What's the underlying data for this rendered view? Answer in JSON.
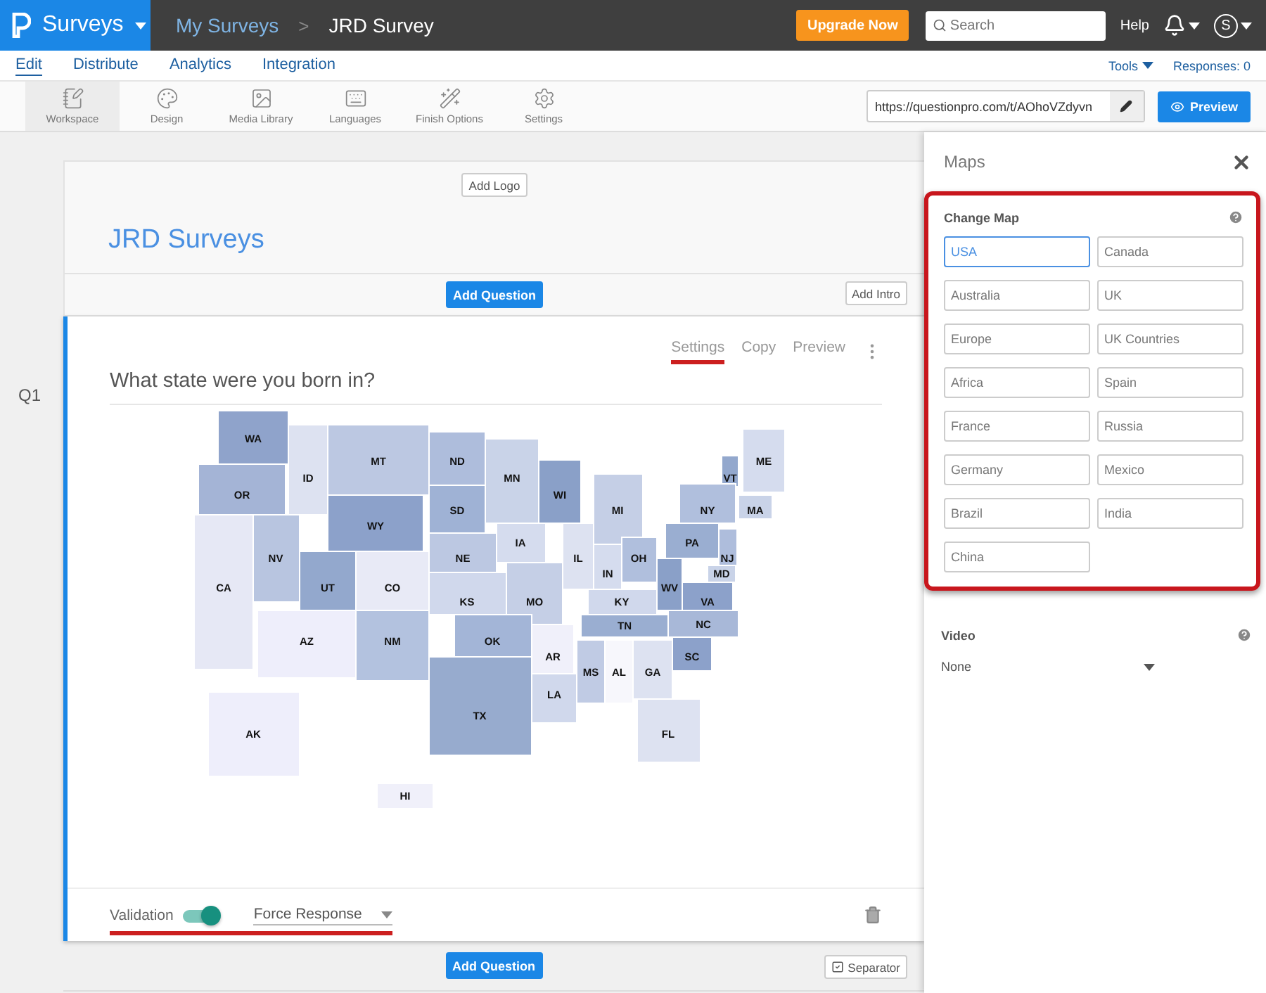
{
  "topbar": {
    "product": "Surveys",
    "breadcrumb": [
      {
        "label": "My Surveys"
      },
      {
        "label": "JRD Survey"
      }
    ],
    "breadcrumb_separator": ">",
    "upgrade": "Upgrade Now",
    "search": {
      "placeholder": "Search"
    },
    "help": "Help",
    "avatar": "S"
  },
  "nav": {
    "tabs": [
      {
        "label": "Edit",
        "selected": true
      },
      {
        "label": "Distribute",
        "selected": false
      },
      {
        "label": "Analytics",
        "selected": false
      },
      {
        "label": "Integration",
        "selected": false
      }
    ],
    "tools": "Tools",
    "responses": "Responses: 0"
  },
  "toolbar": {
    "items": [
      {
        "label": "Workspace",
        "kind": "workspace",
        "selected": true
      },
      {
        "label": "Design",
        "kind": "design",
        "selected": false
      },
      {
        "label": "Media Library",
        "kind": "media",
        "selected": false
      },
      {
        "label": "Languages",
        "kind": "languages",
        "selected": false
      },
      {
        "label": "Finish Options",
        "kind": "finish",
        "selected": false
      },
      {
        "label": "Settings",
        "kind": "settings",
        "selected": false
      }
    ],
    "url": "https://questionpro.com/t/AOhoVZdyvn",
    "preview": "Preview"
  },
  "survey": {
    "add_logo": "Add Logo",
    "title": "JRD Surveys",
    "add_question": "Add Question",
    "add_intro": "Add Intro",
    "question": {
      "number": "Q1",
      "actions": [
        {
          "label": "Settings",
          "highlighted": true
        },
        {
          "label": "Copy",
          "highlighted": false
        },
        {
          "label": "Preview",
          "highlighted": false
        }
      ],
      "text": "What state were you born in?",
      "states": [
        {
          "label": "WA",
          "color": "#8fa3cb"
        },
        {
          "label": "MT",
          "color": "#bcc8e2"
        },
        {
          "label": "ND",
          "color": "#aebddc"
        },
        {
          "label": "ME",
          "color": "#d5dcee"
        },
        {
          "label": "ID",
          "color": "#dde2f1"
        },
        {
          "label": "MN",
          "color": "#c9d3e8"
        },
        {
          "label": "VT",
          "color": "#93a8cd"
        },
        {
          "label": "OR",
          "color": "#a4b4d6"
        },
        {
          "label": "WI",
          "color": "#8aa0c8"
        },
        {
          "label": "SD",
          "color": "#9fb2d5"
        },
        {
          "label": "MI",
          "color": "#c5cfe6"
        },
        {
          "label": "NY",
          "color": "#b0bfdd"
        },
        {
          "label": "MA",
          "color": "#c9d3e8"
        },
        {
          "label": "WY",
          "color": "#8ca1ca"
        },
        {
          "label": "IA",
          "color": "#d5dcee"
        },
        {
          "label": "PA",
          "color": "#9aaed1"
        },
        {
          "label": "NV",
          "color": "#b8c5e0"
        },
        {
          "label": "NE",
          "color": "#bcc8e2"
        },
        {
          "label": "IL",
          "color": "#dde2f1"
        },
        {
          "label": "OH",
          "color": "#b0bfdd"
        },
        {
          "label": "NJ",
          "color": "#aebddc"
        },
        {
          "label": "IN",
          "color": "#d5dcee"
        },
        {
          "label": "MD",
          "color": "#c9d3e8"
        },
        {
          "label": "CA",
          "color": "#e6e8f5"
        },
        {
          "label": "UT",
          "color": "#93a8cd"
        },
        {
          "label": "CO",
          "color": "#e8eaf6"
        },
        {
          "label": "WV",
          "color": "#8aa0c8"
        },
        {
          "label": "KS",
          "color": "#d0d8ec"
        },
        {
          "label": "MO",
          "color": "#c5cfe6"
        },
        {
          "label": "KY",
          "color": "#d0d8ec"
        },
        {
          "label": "VA",
          "color": "#8ca1ca"
        },
        {
          "label": "TN",
          "color": "#9aaed1"
        },
        {
          "label": "NC",
          "color": "#a8b8d8"
        },
        {
          "label": "AZ",
          "color": "#eeeefb"
        },
        {
          "label": "NM",
          "color": "#b3c2df"
        },
        {
          "label": "OK",
          "color": "#a3b5d7"
        },
        {
          "label": "AR",
          "color": "#f0f0fa"
        },
        {
          "label": "SC",
          "color": "#8ca1ca"
        },
        {
          "label": "MS",
          "color": "#c0cbe4"
        },
        {
          "label": "AL",
          "color": "#f7f7fc"
        },
        {
          "label": "GA",
          "color": "#dde2f1"
        },
        {
          "label": "LA",
          "color": "#d0d8ec"
        },
        {
          "label": "TX",
          "color": "#97abce"
        },
        {
          "label": "AK",
          "color": "#eeeefb"
        },
        {
          "label": "FL",
          "color": "#dde2f1"
        },
        {
          "label": "HI",
          "color": "#f0f0fa"
        }
      ],
      "validation": {
        "label": "Validation",
        "on": true,
        "highlighted": true
      },
      "response_type": "Force Response"
    },
    "add_question_2": "Add Question",
    "separator": {
      "label": "Separator",
      "checked": true
    }
  },
  "panel": {
    "title": "Maps",
    "change_map": {
      "label": "Change Map",
      "highlighted": true
    },
    "maps": [
      {
        "label": "USA",
        "selected": true
      },
      {
        "label": "Canada",
        "selected": false
      },
      {
        "label": "Australia",
        "selected": false
      },
      {
        "label": "UK",
        "selected": false
      },
      {
        "label": "Europe",
        "selected": false
      },
      {
        "label": "UK Countries",
        "selected": false
      },
      {
        "label": "Africa",
        "selected": false
      },
      {
        "label": "Spain",
        "selected": false
      },
      {
        "label": "France",
        "selected": false
      },
      {
        "label": "Russia",
        "selected": false
      },
      {
        "label": "Germany",
        "selected": false
      },
      {
        "label": "Mexico",
        "selected": false
      },
      {
        "label": "Brazil",
        "selected": false
      },
      {
        "label": "India",
        "selected": false
      },
      {
        "label": "China",
        "selected": false
      }
    ],
    "video": {
      "label": "Video",
      "value": "None"
    }
  }
}
